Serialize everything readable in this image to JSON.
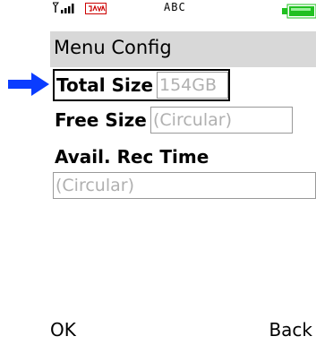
{
  "status_bar": {
    "signal_icon": "signal-strength-icon",
    "java_icon": "java-icon",
    "carrier": "ABC",
    "battery_icon": "battery-icon"
  },
  "title": "Menu Config",
  "form": {
    "total_size": {
      "label": "Total Size",
      "value": "154GB"
    },
    "free_size": {
      "label": "Free Size",
      "value": "(Circular)"
    },
    "avail_rec_time": {
      "label": "Avail. Rec Time",
      "value": "(Circular)"
    }
  },
  "softkeys": {
    "left": "OK",
    "right": "Back"
  },
  "colors": {
    "pointer_arrow": "#0a3cff",
    "title_bar_bg": "#d8d8d8",
    "battery_fill": "#20c020",
    "java_red": "#cc0000",
    "field_text": "#b0b0b0"
  }
}
